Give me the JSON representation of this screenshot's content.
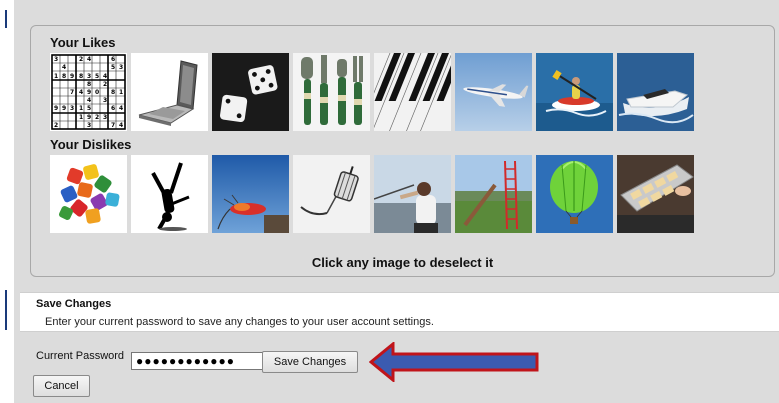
{
  "likes": {
    "title": "Your Likes",
    "images": [
      {
        "icon": "sudoku-puzzle"
      },
      {
        "icon": "laptop"
      },
      {
        "icon": "dice"
      },
      {
        "icon": "garden-tools"
      },
      {
        "icon": "piano-keys"
      },
      {
        "icon": "airplane"
      },
      {
        "icon": "kayaker"
      },
      {
        "icon": "speedboat"
      }
    ]
  },
  "dislikes": {
    "title": "Your Dislikes",
    "images": [
      {
        "icon": "puzzle-pieces"
      },
      {
        "icon": "breakdancer-silhouette"
      },
      {
        "icon": "fishing-fly"
      },
      {
        "icon": "lantern-hook"
      },
      {
        "icon": "person-fishing"
      },
      {
        "icon": "red-ladder"
      },
      {
        "icon": "hot-air-balloon"
      },
      {
        "icon": "baking-tray"
      }
    ]
  },
  "hint": "Click any image to deselect it",
  "save_section": {
    "title": "Save Changes",
    "description": "Enter your current password to save any changes to your user account settings."
  },
  "password": {
    "label": "Current Password",
    "value": "●●●●●●●●●●●●"
  },
  "buttons": {
    "save": "Save Changes",
    "cancel": "Cancel"
  },
  "colors": {
    "arrow_fill": "#3b5bb0",
    "arrow_outline": "#c0141a",
    "panel_bg": "#dcdcdc"
  }
}
